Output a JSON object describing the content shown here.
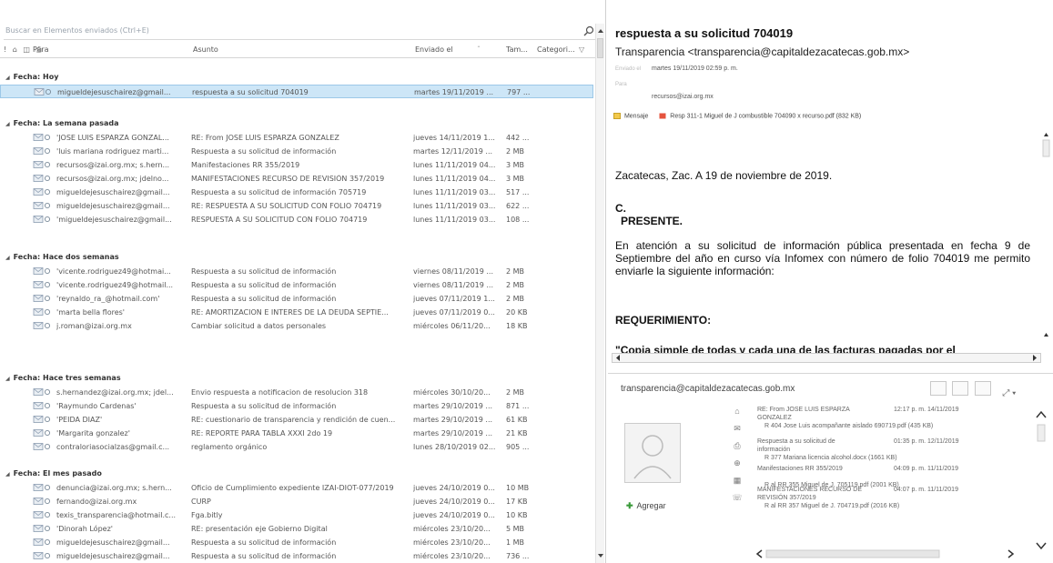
{
  "search": {
    "placeholder": "Buscar en Elementos enviados (Ctrl+E)"
  },
  "columns": {
    "icons": "! ⌂ ◫ ⎙",
    "para": "Para",
    "asunto": "Asunto",
    "enviado": "Enviado el",
    "tamano": "Tam...",
    "categorias": "Categori..."
  },
  "groups": [
    {
      "label": "Fecha: Hoy",
      "rows": [
        {
          "to": "migueldejesuschairez@gmail...",
          "subject": "respuesta a su solicitud 704019",
          "date": "martes 19/11/2019 ...",
          "size": "797 ...",
          "selected": true
        }
      ]
    },
    {
      "label": "Fecha: La semana pasada",
      "rows": [
        {
          "to": "'JOSE LUIS ESPARZA GONZAL...",
          "subject": "RE: From JOSE LUIS ESPARZA GONZALEZ",
          "date": "jueves 14/11/2019 1...",
          "size": "442 ..."
        },
        {
          "to": "'luis mariana rodriguez marti...",
          "subject": "Respuesta a su solicitud de información",
          "date": "martes 12/11/2019 ...",
          "size": "2 MB"
        },
        {
          "to": "recursos@izai.org.mx; s.hern...",
          "subject": "Manifestaciones RR 355/2019",
          "date": "lunes 11/11/2019 04...",
          "size": "3 MB"
        },
        {
          "to": "recursos@izai.org.mx; jdelno...",
          "subject": "MANIFESTACIONES RECURSO DE REVISIÓN 357/2019",
          "date": "lunes 11/11/2019 04...",
          "size": "3 MB"
        },
        {
          "to": "migueldejesuschairez@gmail...",
          "subject": "Respuesta a su solicitud de información 705719",
          "date": "lunes 11/11/2019 03...",
          "size": "517 ..."
        },
        {
          "to": "migueldejesuschairez@gmail...",
          "subject": "RE: RESPUESTA A SU SOLICITUD CON FOLIO 704719",
          "date": "lunes 11/11/2019 03...",
          "size": "622 ..."
        },
        {
          "to": "'migueldejesuschairez@gmail...",
          "subject": "RESPUESTA A SU SOLICITUD CON FOLIO 704719",
          "date": "lunes 11/11/2019 03...",
          "size": "108 ..."
        }
      ]
    },
    {
      "label": "Fecha: Hace dos semanas",
      "rows": [
        {
          "to": "'vicente.rodriguez49@hotmai...",
          "subject": "Respuesta a su solicitud de información",
          "date": "viernes 08/11/2019 ...",
          "size": "2 MB"
        },
        {
          "to": "'vicente.rodriguez49@hotmail...",
          "subject": "Respuesta a su solicitud de información",
          "date": "viernes 08/11/2019 ...",
          "size": "2 MB"
        },
        {
          "to": "'reynaldo_ra_@hotmail.com'",
          "subject": "Respuesta a su solicitud de información",
          "date": "jueves 07/11/2019 1...",
          "size": "2 MB"
        },
        {
          "to": "'marta bella flores'",
          "subject": "RE: AMORTIZACION E INTERES DE LA DEUDA SEPTIE...",
          "date": "jueves 07/11/2019 0...",
          "size": "20 KB"
        },
        {
          "to": "j.roman@izai.org.mx",
          "subject": "Cambiar solicitud a datos personales",
          "date": "miércoles 06/11/20...",
          "size": "18 KB"
        }
      ]
    },
    {
      "label": "Fecha: Hace tres semanas",
      "rows": [
        {
          "to": "s.hernandez@izai.org.mx; jdel...",
          "subject": "Envio respuesta a notificacion de resolucion 318",
          "date": "miércoles 30/10/20...",
          "size": "2 MB"
        },
        {
          "to": "'Raymundo Cardenas'",
          "subject": "Respuesta a su solicitud de información",
          "date": "martes 29/10/2019 ...",
          "size": "871 ..."
        },
        {
          "to": "'PEIDA DIAZ'",
          "subject": "RE: cuestionario de transparencia y rendición de cuen...",
          "date": "martes 29/10/2019 ...",
          "size": "61 KB"
        },
        {
          "to": "'Margarita gonzalez'",
          "subject": "RE: REPORTE PARA TABLA XXXI 2do 19",
          "date": "martes 29/10/2019 ...",
          "size": "21 KB"
        },
        {
          "to": "contraloriasocialzas@gmail.c...",
          "subject": "reglamento orgánico",
          "date": "lunes 28/10/2019 02...",
          "size": "905 ..."
        }
      ]
    },
    {
      "label": "Fecha: El mes pasado",
      "rows": [
        {
          "to": "denuncia@izai.org.mx; s.hern...",
          "subject": "Oficio de Cumplimiento expediente IZAI-DIOT-077/2019",
          "date": "jueves 24/10/2019 0...",
          "size": "10 MB"
        },
        {
          "to": "fernando@izai.org.mx",
          "subject": "CURP",
          "date": "jueves 24/10/2019 0...",
          "size": "17 KB"
        },
        {
          "to": "texis_transparencia@hotmail.c...",
          "subject": "Fga.bitly",
          "date": "jueves 24/10/2019 0...",
          "size": "10 KB"
        },
        {
          "to": "'Dinorah López'",
          "subject": "RE: presentación eje Gobierno Digital",
          "date": "miércoles 23/10/20...",
          "size": "5 MB"
        },
        {
          "to": "migueldejesuschairez@gmail...",
          "subject": "Respuesta a su solicitud de información",
          "date": "miércoles 23/10/20...",
          "size": "1 MB"
        },
        {
          "to": "migueldejesuschairez@gmail...",
          "subject": "Respuesta a su solicitud de información",
          "date": "miércoles 23/10/20...",
          "size": "736 ..."
        }
      ]
    }
  ],
  "message": {
    "subject": "respuesta a su solicitud 704019",
    "from": "Transparencia <transparencia@capitaldezacatecas.gob.mx>",
    "sent_label": "Enviado el",
    "sent": "martes 19/11/2019 02:59 p. m.",
    "to_label": "Para",
    "to": "recursos@izai.org.mx",
    "msg_tab": "Mensaje",
    "attachment": "Resp 311-1 Miguel de J combustible 704090 x recurso.pdf (832 KB)",
    "body": {
      "date_line": "Zacatecas, Zac.  A  19 de noviembre de 2019.",
      "c": "C.",
      "presente": "PRESENTE.",
      "intro": "En atención a su solicitud de información pública presentada en fecha 9 de Septiembre del año en curso vía Infomex con número de folio 704019 me permito enviarle la siguiente información:",
      "req": "REQUERIMIENTO:",
      "copia": "\"Copia simple de todas y cada una de las facturas pagadas por el"
    }
  },
  "people": {
    "email": "transparencia@capitaldezacatecas.gob.mx",
    "add": "Agregar",
    "threads": [
      {
        "l1": "RE: From JOSE LUIS ESPARZA",
        "time": "12:17 p. m. 14/11/2019",
        "l2": "GONZALEZ",
        "att": "R 404 Jose Luis acompañante aislado 690719.pdf (435 KB)"
      },
      {
        "l1": "Respuesta a su solicitud de",
        "time": "01:35 p. m. 12/11/2019",
        "l2": "información",
        "att": "R 377 Mariana licencia alcohol.docx (1661 KB)"
      },
      {
        "l1": "Manifestaciones RR 355/2019",
        "time": "04:09 p. m. 11/11/2019",
        "l2": "",
        "att": "R al RR 355 Miguel de J. 705119.pdf (2001 KB)"
      },
      {
        "l1": "MANIFESTACIONES RECURSO DE",
        "time": "04:07 p. m. 11/11/2019",
        "l2": "REVISIÓN 357/2019",
        "att": "R al RR 357 Miguel de J. 704719.pdf (2016 KB)"
      }
    ]
  },
  "colors": {
    "selected_row": "#cde6f7",
    "group_header": "#333333"
  }
}
